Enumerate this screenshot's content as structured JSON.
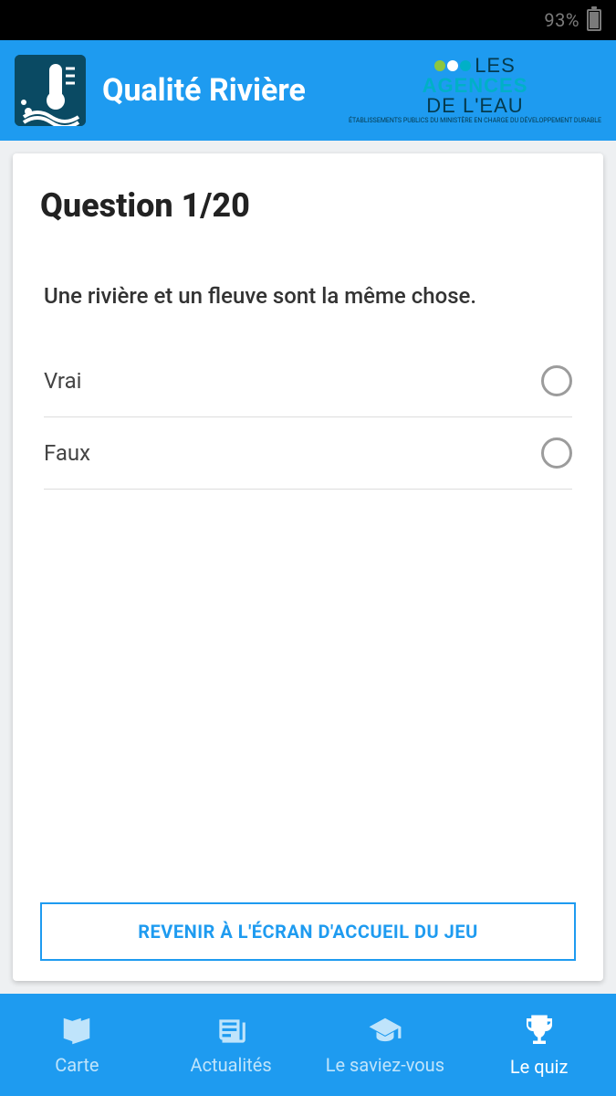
{
  "status": {
    "battery_pct": "93%"
  },
  "header": {
    "title": "Qualité Rivière"
  },
  "brand": {
    "line1": "LES",
    "line2": "AGENCES",
    "line3": "DE L'EAU",
    "sub": "ÉTABLISSEMENTS PUBLICS DU MINISTÈRE\nEN CHARGE DU DÉVELOPPEMENT DURABLE"
  },
  "quiz": {
    "counter": "Question 1/20",
    "question": "Une rivière et un fleuve sont la même chose.",
    "answers": [
      {
        "label": "Vrai"
      },
      {
        "label": "Faux"
      }
    ],
    "home_button": "REVENIR À L'ÉCRAN D'ACCUEIL DU JEU"
  },
  "nav": {
    "items": [
      {
        "label": "Carte",
        "icon": "map-icon",
        "active": false
      },
      {
        "label": "Actualités",
        "icon": "news-icon",
        "active": false
      },
      {
        "label": "Le saviez-vous",
        "icon": "learn-icon",
        "active": false
      },
      {
        "label": "Le quiz",
        "icon": "trophy-icon",
        "active": true
      }
    ]
  }
}
